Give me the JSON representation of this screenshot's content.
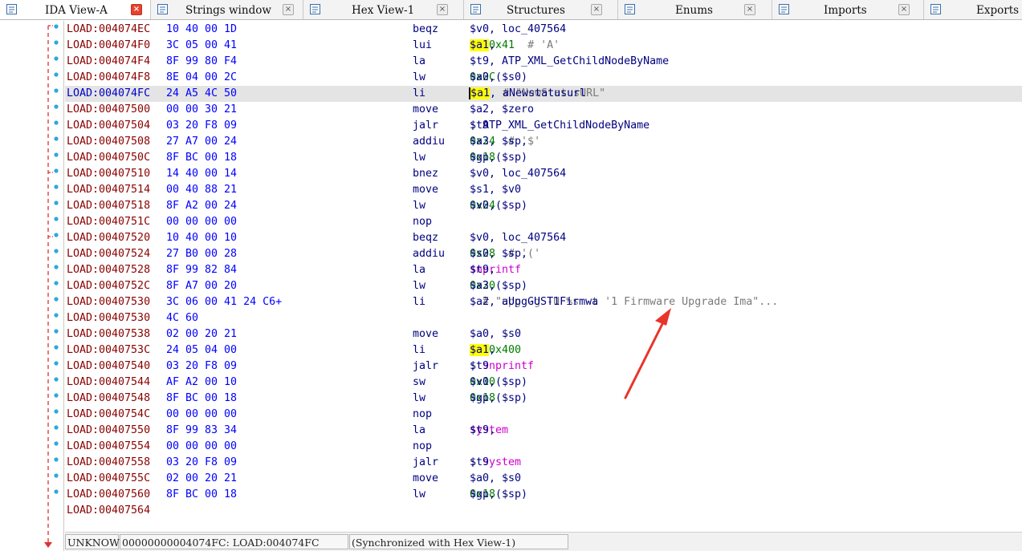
{
  "tabs": [
    {
      "label": "IDA View-A",
      "icon": "ida-view-icon",
      "active": true
    },
    {
      "label": "Strings window",
      "icon": "strings-icon",
      "active": false
    },
    {
      "label": "Hex View-1",
      "icon": "hex-view-icon",
      "active": false
    },
    {
      "label": "Structures",
      "icon": "structures-icon",
      "active": false
    },
    {
      "label": "Enums",
      "icon": "enums-icon",
      "active": false
    },
    {
      "label": "Imports",
      "icon": "imports-icon",
      "active": false
    },
    {
      "label": "Exports",
      "icon": "exports-icon",
      "active": false
    }
  ],
  "close_glyph": "×",
  "listing": [
    {
      "addr": "LOAD:004074EC",
      "bytes": "10 40 00 1D",
      "mnem": "beqz",
      "ops": [
        [
          "p",
          "$v0, loc_407564"
        ]
      ]
    },
    {
      "addr": "LOAD:004074F0",
      "bytes": "3C 05 00 41",
      "mnem": "lui",
      "ops": [
        [
          "hl",
          "$a1"
        ],
        [
          "p",
          ", "
        ],
        [
          "num",
          "0x41"
        ],
        [
          "cmt",
          "  # 'A'"
        ]
      ]
    },
    {
      "addr": "LOAD:004074F4",
      "bytes": "8F 99 80 F4",
      "mnem": "la",
      "ops": [
        [
          "p",
          "$t9, ATP_XML_GetChildNodeByName"
        ]
      ]
    },
    {
      "addr": "LOAD:004074F8",
      "bytes": "8E 04 00 2C",
      "mnem": "lw",
      "ops": [
        [
          "p",
          "$a0, "
        ],
        [
          "num",
          "0x2C"
        ],
        [
          "p",
          "($s0)"
        ]
      ]
    },
    {
      "addr": "LOAD:004074FC",
      "bytes": "24 A5 4C 50",
      "mnem": "li",
      "current": true,
      "ops": [
        [
          "caret",
          ""
        ],
        [
          "hl",
          "$a1"
        ],
        [
          "p",
          ", aNewstatusurl"
        ],
        [
          "cmt",
          "  # \"NewStatusURL\""
        ]
      ]
    },
    {
      "addr": "LOAD:00407500",
      "bytes": "00 00 30 21",
      "mnem": "move",
      "ops": [
        [
          "p",
          "$a2, $zero"
        ]
      ]
    },
    {
      "addr": "LOAD:00407504",
      "bytes": "03 20 F8 09",
      "mnem": "jalr",
      "ops": [
        [
          "p",
          "$t9 "
        ],
        [
          "semi",
          "; "
        ],
        [
          "fn",
          "ATP_XML_GetChildNodeByName"
        ]
      ]
    },
    {
      "addr": "LOAD:00407508",
      "bytes": "27 A7 00 24",
      "mnem": "addiu",
      "ops": [
        [
          "p",
          "$a3, $sp, "
        ],
        [
          "num",
          "0x24"
        ],
        [
          "cmt",
          "  # '$'"
        ]
      ]
    },
    {
      "addr": "LOAD:0040750C",
      "bytes": "8F BC 00 18",
      "mnem": "lw",
      "ops": [
        [
          "p",
          "$gp, "
        ],
        [
          "num",
          "0x18"
        ],
        [
          "p",
          "($sp)"
        ]
      ]
    },
    {
      "addr": "LOAD:00407510",
      "bytes": "14 40 00 14",
      "mnem": "bnez",
      "ops": [
        [
          "p",
          "$v0, loc_407564"
        ]
      ]
    },
    {
      "addr": "LOAD:00407514",
      "bytes": "00 40 88 21",
      "mnem": "move",
      "ops": [
        [
          "p",
          "$s1, $v0"
        ]
      ]
    },
    {
      "addr": "LOAD:00407518",
      "bytes": "8F A2 00 24",
      "mnem": "lw",
      "ops": [
        [
          "p",
          "$v0, "
        ],
        [
          "num",
          "0x24"
        ],
        [
          "p",
          "($sp)"
        ]
      ]
    },
    {
      "addr": "LOAD:0040751C",
      "bytes": "00 00 00 00",
      "mnem": "nop",
      "ops": []
    },
    {
      "addr": "LOAD:00407520",
      "bytes": "10 40 00 10",
      "mnem": "beqz",
      "ops": [
        [
          "p",
          "$v0, loc_407564"
        ]
      ]
    },
    {
      "addr": "LOAD:00407524",
      "bytes": "27 B0 00 28",
      "mnem": "addiu",
      "ops": [
        [
          "p",
          "$s0, $sp, "
        ],
        [
          "num",
          "0x28"
        ],
        [
          "cmt",
          "  # '('"
        ]
      ]
    },
    {
      "addr": "LOAD:00407528",
      "bytes": "8F 99 82 84",
      "mnem": "la",
      "ops": [
        [
          "p",
          "$t9, "
        ],
        [
          "mag",
          "snprintf"
        ]
      ]
    },
    {
      "addr": "LOAD:0040752C",
      "bytes": "8F A7 00 20",
      "mnem": "lw",
      "ops": [
        [
          "p",
          "$a3, "
        ],
        [
          "num",
          "0x20"
        ],
        [
          "p",
          "($sp)"
        ]
      ]
    },
    {
      "addr": "LOAD:00407530",
      "bytes": "3C 06 00 41 24 C6+",
      "mnem": "li",
      "ops": [
        [
          "p",
          "$a2, aUpgGUST1Firmwa"
        ],
        [
          "cmt",
          "  # \"upg -g -U %s -t '1 Firmware Upgrade Ima\"..."
        ]
      ]
    },
    {
      "addr": "LOAD:00407530",
      "bytes": "4C 60",
      "mnem": "",
      "ops": []
    },
    {
      "addr": "LOAD:00407538",
      "bytes": "02 00 20 21",
      "mnem": "move",
      "ops": [
        [
          "p",
          "$a0, $s0"
        ]
      ]
    },
    {
      "addr": "LOAD:0040753C",
      "bytes": "24 05 04 00",
      "mnem": "li",
      "ops": [
        [
          "hl",
          "$a1"
        ],
        [
          "p",
          ", "
        ],
        [
          "num",
          "0x400"
        ]
      ]
    },
    {
      "addr": "LOAD:00407540",
      "bytes": "03 20 F8 09",
      "mnem": "jalr",
      "ops": [
        [
          "p",
          "$t9 "
        ],
        [
          "semi",
          "; "
        ],
        [
          "mag",
          "snprintf"
        ]
      ]
    },
    {
      "addr": "LOAD:00407544",
      "bytes": "AF A2 00 10",
      "mnem": "sw",
      "ops": [
        [
          "p",
          "$v0, "
        ],
        [
          "num",
          "0x10"
        ],
        [
          "p",
          "($sp)"
        ]
      ]
    },
    {
      "addr": "LOAD:00407548",
      "bytes": "8F BC 00 18",
      "mnem": "lw",
      "ops": [
        [
          "p",
          "$gp, "
        ],
        [
          "num",
          "0x18"
        ],
        [
          "p",
          "($sp)"
        ]
      ]
    },
    {
      "addr": "LOAD:0040754C",
      "bytes": "00 00 00 00",
      "mnem": "nop",
      "ops": []
    },
    {
      "addr": "LOAD:00407550",
      "bytes": "8F 99 83 34",
      "mnem": "la",
      "ops": [
        [
          "p",
          "$t9, "
        ],
        [
          "mag",
          "system"
        ]
      ]
    },
    {
      "addr": "LOAD:00407554",
      "bytes": "00 00 00 00",
      "mnem": "nop",
      "ops": []
    },
    {
      "addr": "LOAD:00407558",
      "bytes": "03 20 F8 09",
      "mnem": "jalr",
      "ops": [
        [
          "p",
          "$t9 "
        ],
        [
          "semi",
          "; "
        ],
        [
          "mag",
          "system"
        ]
      ]
    },
    {
      "addr": "LOAD:0040755C",
      "bytes": "02 00 20 21",
      "mnem": "move",
      "ops": [
        [
          "p",
          "$a0, $s0"
        ]
      ]
    },
    {
      "addr": "LOAD:00407560",
      "bytes": "8F BC 00 18",
      "mnem": "lw",
      "ops": [
        [
          "p",
          "$gp, "
        ],
        [
          "num",
          "0x18"
        ],
        [
          "p",
          "($sp)"
        ]
      ]
    },
    {
      "addr": "LOAD:00407564",
      "bytes": "",
      "mnem": "",
      "ops": []
    }
  ],
  "status": {
    "mode": "UNKNOWN",
    "location": "00000000004074FC: LOAD:004074FC",
    "sync": "(Synchronized with Hex View-1)"
  },
  "colors": {
    "address": "#8b0000",
    "bytes": "#0000ff",
    "mnemonic": "#000080",
    "number": "#007a00",
    "highlight": "#ffff00",
    "comment": "#7a7a7a",
    "import": "#cc00cc",
    "annotation_arrow": "#e8342a"
  }
}
